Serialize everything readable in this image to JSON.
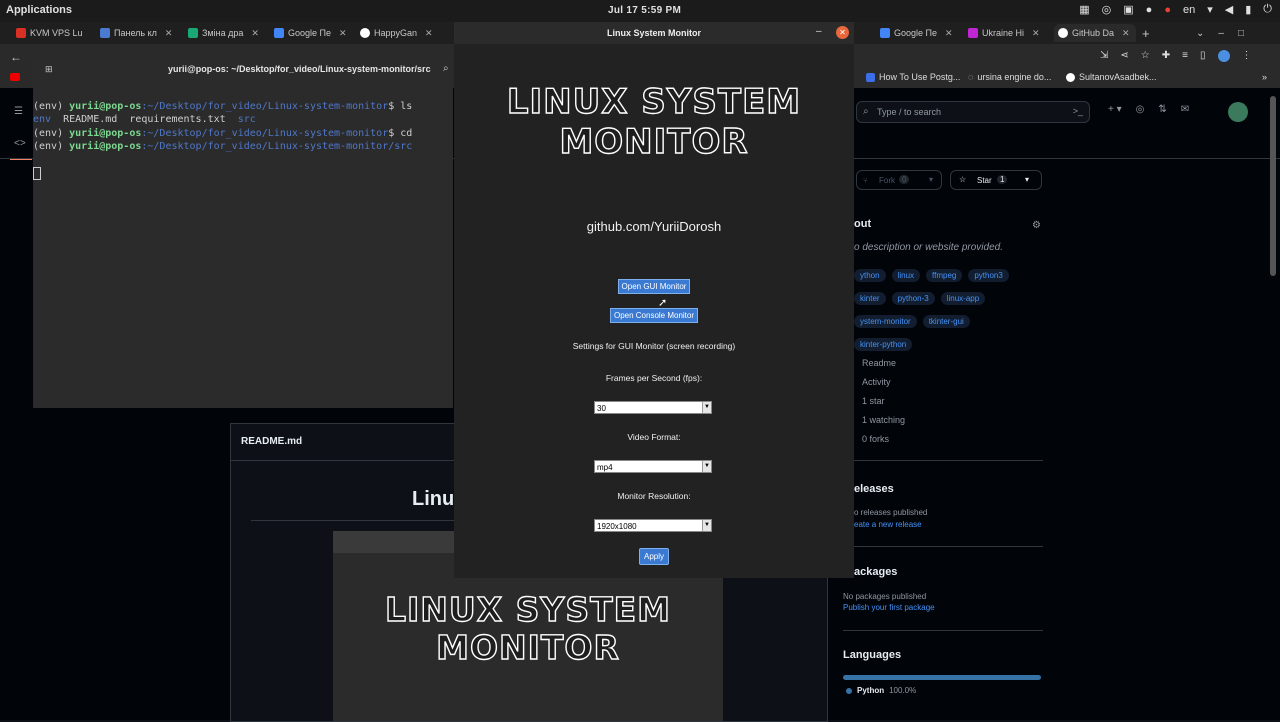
{
  "topbar": {
    "apps": "Applications",
    "clock": "Jul 17   5:59 PM",
    "lang": "en"
  },
  "tabs": [
    {
      "label": "KVM VPS Lu",
      "color": "#d93025"
    },
    {
      "label": "Панель кл",
      "color": "#4a7bd0"
    },
    {
      "label": "Зміна дра",
      "color": "#19a974"
    },
    {
      "label": "Google Пе",
      "color": "#4285f4"
    },
    {
      "label": "HappyGan",
      "color": "#ffffff"
    },
    {
      "label": "Google Пе",
      "color": "#4285f4"
    },
    {
      "label": "Ukraine Hi",
      "color": "#c026d3"
    },
    {
      "label": "GitHub Da",
      "color": "#ffffff"
    }
  ],
  "bookmarks": {
    "items": [
      {
        "label": "How To Use Postg..."
      },
      {
        "label": "ursina engine do..."
      },
      {
        "label": "SultanovAsadbek..."
      }
    ]
  },
  "terminal": {
    "title": "yurii@pop-os: ~/Desktop/for_video/Linux-system-monitor/src",
    "lines": [
      {
        "env": "(env) ",
        "user": "yurii@pop-os",
        "path": ":~/Desktop/for_video/Linux-system-monitor",
        "cmd": "$ ls"
      },
      {
        "raw_env": "env",
        "rest": "  README.md  requirements.txt  ",
        "src": "src"
      },
      {
        "env": "(env) ",
        "user": "yurii@pop-os",
        "path": ":~/Desktop/for_video/Linux-system-monitor",
        "cmd": "$ cd"
      },
      {
        "env": "(env) ",
        "user": "yurii@pop-os",
        "path": ":~/Desktop/for_video/Linux-system-monitor/src",
        "cmd": ""
      }
    ]
  },
  "github": {
    "search_placeholder": "Type / to search",
    "fork_label": "Fork",
    "fork_count": "0",
    "star_label": "Star",
    "star_count": "1",
    "about_title": "out",
    "about_desc": "o description or website provided.",
    "topics": [
      "ython",
      "linux",
      "ffmpeg",
      "python3",
      "kinter",
      "python-3",
      "linux-app",
      "ystem-monitor",
      "tkinter-gui",
      "kinter-python"
    ],
    "side": [
      "Readme",
      "Activity",
      "1 star",
      "1 watching",
      "0 forks"
    ],
    "releases_title": "eleases",
    "releases_none": "o releases published",
    "releases_link": "eate a new release",
    "packages_title": "ackages",
    "packages_none": "No packages published",
    "packages_link": "Publish your first package",
    "languages_title": "Languages",
    "language": "Python",
    "language_pct": "100.0%"
  },
  "readme": {
    "file": "README.md",
    "heading_partial": "Linu",
    "logo_line1": "LINUX SYSTEM",
    "logo_line2": "MONITOR"
  },
  "app": {
    "window_title": "Linux System Monitor",
    "title_line1": "LINUX SYSTEM",
    "title_line2": "MONITOR",
    "link": "github.com/YuriiDorosh",
    "btn_gui": "Open GUI Monitor",
    "btn_console": "Open Console Monitor",
    "settings_label": "Settings for GUI Monitor (screen recording)",
    "fps_label": "Frames per Second (fps):",
    "fps_value": "30",
    "format_label": "Video Format:",
    "format_value": "mp4",
    "res_label": "Monitor Resolution:",
    "res_value": "1920x1080",
    "apply": "Apply"
  }
}
